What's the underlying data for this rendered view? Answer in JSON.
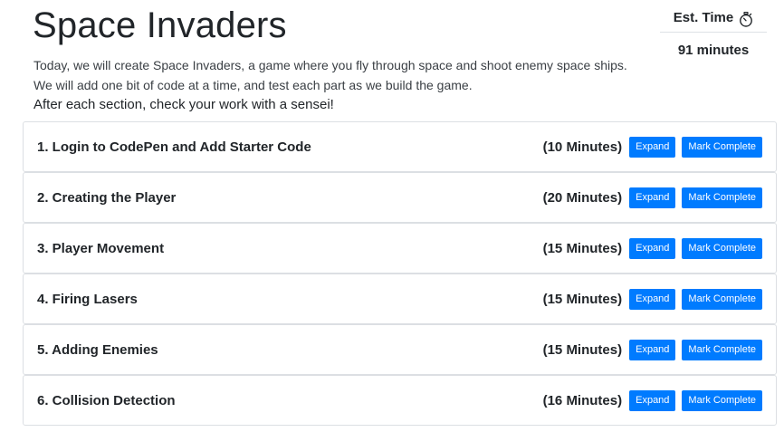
{
  "header": {
    "title": "Space Invaders",
    "intro_lines": [
      "Today, we will create Space Invaders, a game where you fly through space and shoot enemy space ships.",
      "We will add one bit of code at a time, and test each part as we build the game.",
      "After each section, check your work with a sensei!"
    ]
  },
  "estimate": {
    "label": "Est. Time",
    "icon": "stopwatch-icon",
    "value": "91 minutes"
  },
  "buttons": {
    "expand": "Expand",
    "mark_complete": "Mark Complete"
  },
  "colors": {
    "primary": "#007bff",
    "border": "#dcdfe3",
    "text": "#212529"
  },
  "sections": [
    {
      "title": "1. Login to CodePen and Add Starter Code",
      "duration": "(10 Minutes)"
    },
    {
      "title": "2. Creating the Player",
      "duration": "(20 Minutes)"
    },
    {
      "title": "3. Player Movement",
      "duration": "(15 Minutes)"
    },
    {
      "title": "4. Firing Lasers",
      "duration": "(15 Minutes)"
    },
    {
      "title": "5. Adding Enemies",
      "duration": "(15 Minutes)"
    },
    {
      "title": "6. Collision Detection",
      "duration": "(16 Minutes)"
    }
  ]
}
